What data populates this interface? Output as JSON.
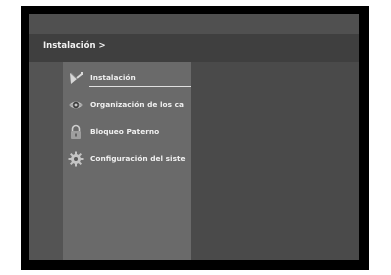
{
  "breadcrumb": "Instalación >",
  "menu": {
    "items": [
      {
        "label": "Instalación",
        "icon": "satellite-dish-icon",
        "selected": true
      },
      {
        "label": "Organización de los ca",
        "icon": "eye-icon",
        "selected": false
      },
      {
        "label": "Bloqueo Paterno",
        "icon": "padlock-icon",
        "selected": false
      },
      {
        "label": "Configuración del siste",
        "icon": "gear-icon",
        "selected": false
      }
    ]
  },
  "colors": {
    "frame": "#000000",
    "background": "#505050",
    "header": "#3f3f3f",
    "menu_panel": "#6a6a6a",
    "text": "#f0f0f0"
  }
}
